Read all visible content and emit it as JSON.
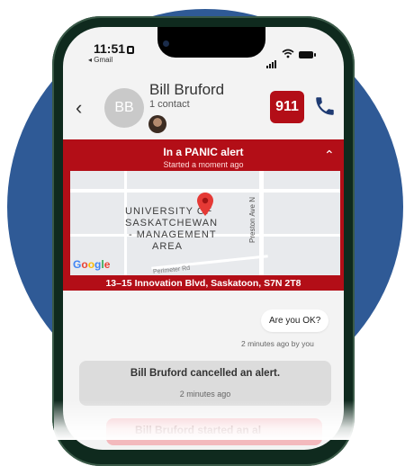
{
  "status_bar": {
    "time": "11:51",
    "back_app": "◂ Gmail"
  },
  "header": {
    "back_icon": "chevron-left-icon",
    "avatar_initials": "BB",
    "contact_name": "Bill Bruford",
    "contact_sub": "1 contact",
    "emergency_button": "911",
    "call_icon": "phone-icon"
  },
  "alert": {
    "title": "In a PANIC alert",
    "subtitle": "Started a moment ago",
    "collapse_icon": "chevron-up-icon",
    "map": {
      "place_label": [
        "UNIVERSITY OF",
        "SASKATCHEWAN",
        "- MANAGEMENT",
        "AREA"
      ],
      "street_label": "Preston Ave N",
      "road_label": "Perimeter Rd",
      "brand": "Google",
      "pin_icon": "map-pin-icon"
    },
    "address": "13–15 Innovation Blvd, Saskatoon, S7N 2T8"
  },
  "messages": {
    "outgoing_text": "Are you OK?",
    "outgoing_meta": "2 minutes ago by you",
    "cancel_card": {
      "title": "Bill Bruford cancelled an alert.",
      "time": "2 minutes ago"
    },
    "start_card": {
      "title": "Bill Bruford started an al"
    }
  },
  "colors": {
    "brand_red": "#b30e17",
    "navy": "#1f3b73",
    "background_circle": "#2f5a96"
  }
}
